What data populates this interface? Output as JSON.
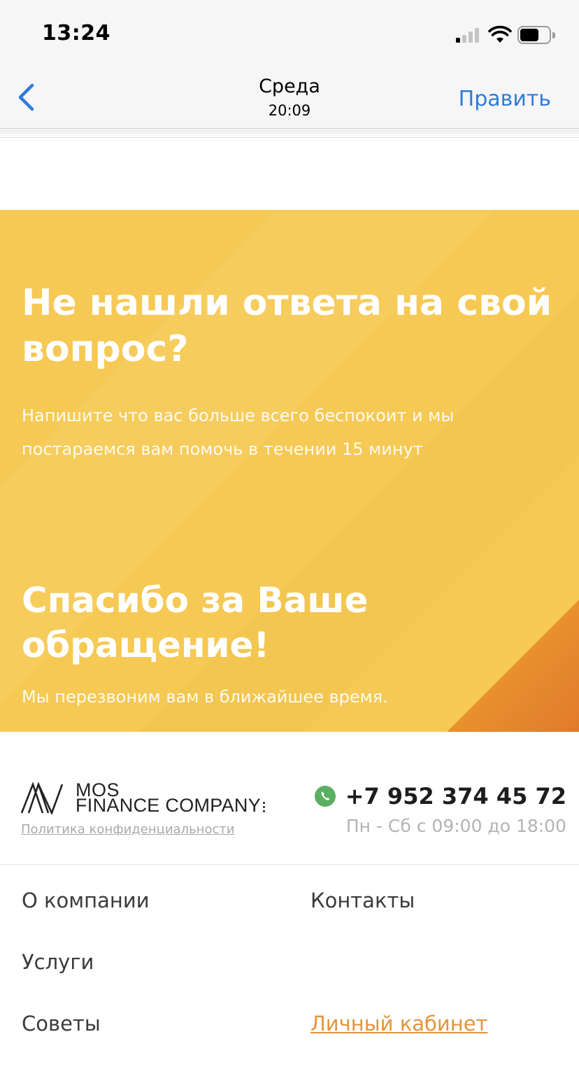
{
  "status_bar": {
    "time": "13:24",
    "icons": [
      "signal-icon",
      "wifi-icon",
      "battery-icon"
    ]
  },
  "nav_bar": {
    "back_icon": "chevron-left-icon",
    "title": "Среда",
    "subtitle": "20:09",
    "edit_label": "Править"
  },
  "banner": {
    "title": "Не нашли ответа на свой вопрос?",
    "text": "Напишите что вас больше всего беспокоит и мы постараемся вам помочь в течении 15 минут",
    "thanks_title": "Спасибо за Ваше обращение!",
    "thanks_text": "Мы перезвоним вам в ближайшее время."
  },
  "footer": {
    "logo": {
      "line1": "MOS",
      "line2": "FINANCE COMPANY"
    },
    "privacy_link": "Политика конфиденциальности",
    "phone_icon": "phone-icon",
    "phone": "+7 952 374 45 72",
    "hours": "Пн - Сб с 09:00 до 18:00",
    "menu": {
      "about": "О компании",
      "contacts": "Контакты",
      "services": "Услуги",
      "tips": "Советы",
      "cabinet": "Личный кабинет"
    }
  },
  "colors": {
    "accent_blue": "#2f7bd9",
    "banner_yellow": "#f5c954",
    "banner_orange": "#e07a2c",
    "cabinet_orange": "#e4953c",
    "phone_green": "#5cae63"
  }
}
